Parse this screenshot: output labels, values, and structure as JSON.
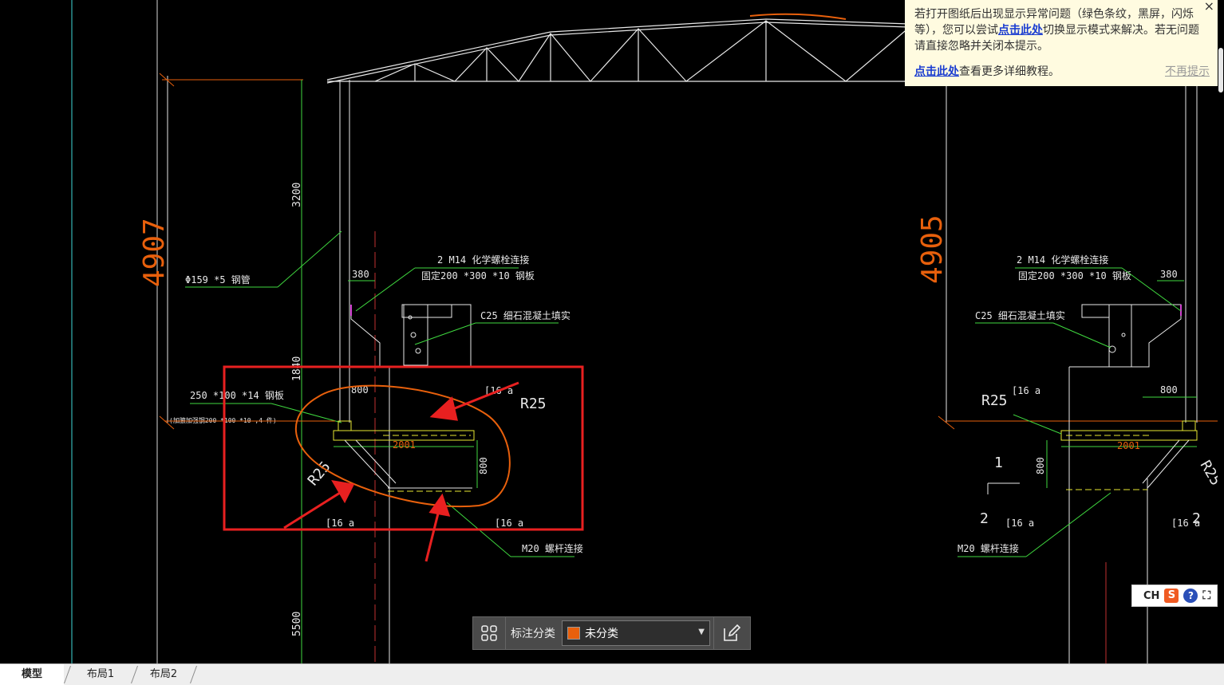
{
  "drawing": {
    "left_detail": {
      "total_height": "4907",
      "dim_upper": "3200",
      "dim_middle": "1840",
      "dim_lower": "5500",
      "pipe_label": "Φ159 *5 钢管",
      "bolt_label_1": "2 M14 化学螺栓连接",
      "bolt_label_2": "固定200 *300 *10 钢板",
      "width_380": "380",
      "concrete_label": "C25 细石混凝土填实",
      "plate_label": "250 *100 *14 钢板",
      "support_label": "(加腋加强钢200 *100 *10 ,4 件)",
      "dim_800_top": "800",
      "dim_2001": "2001",
      "dim_800_side": "800",
      "channel_tl": "[16 a",
      "channel_bl": "[16 a",
      "channel_br": "[16 a",
      "radius_1": "R25",
      "radius_2": "R25",
      "bolt_m20": "M20 螺杆连接"
    },
    "right_detail": {
      "total_height": "4905",
      "bolt_label_1": "2 M14 化学螺栓连接",
      "bolt_label_2": "固定200 *300 *10 钢板",
      "width_380": "380",
      "concrete_label": "C25 细石混凝土填实",
      "radius_1": "R25",
      "radius_2": "R25",
      "channel_tl": "[16 a",
      "channel_bl": "[16 a",
      "channel_br": "[16 a",
      "dim_800_top": "800",
      "dim_2001": "2001",
      "dim_800_side": "800",
      "section_1": "1",
      "section_2a": "2",
      "section_2b": "2",
      "bolt_m20": "M20 螺杆连接"
    }
  },
  "notice": {
    "line1": "若打开图纸后出现显示异常问题（绿色条纹，黑屏，闪烁等），您可以尝试",
    "link1": "点击此处",
    "line1b": "切换显示模式来解决。若无问题请直接忽略并关闭本提示。",
    "link2": "点击此处",
    "line2": "查看更多详细教程。",
    "dismiss": "不再提示",
    "close": "×"
  },
  "ime": {
    "lang": "CH",
    "logo": "S",
    "help": "?",
    "expand": "⛶"
  },
  "annotation_bar": {
    "label": "标注分类",
    "selected": "未分类",
    "swatch_color": "#e8600c"
  },
  "tabs": [
    {
      "label": "模型",
      "active": true
    },
    {
      "label": "布局1",
      "active": false
    },
    {
      "label": "布局2",
      "active": false
    }
  ]
}
